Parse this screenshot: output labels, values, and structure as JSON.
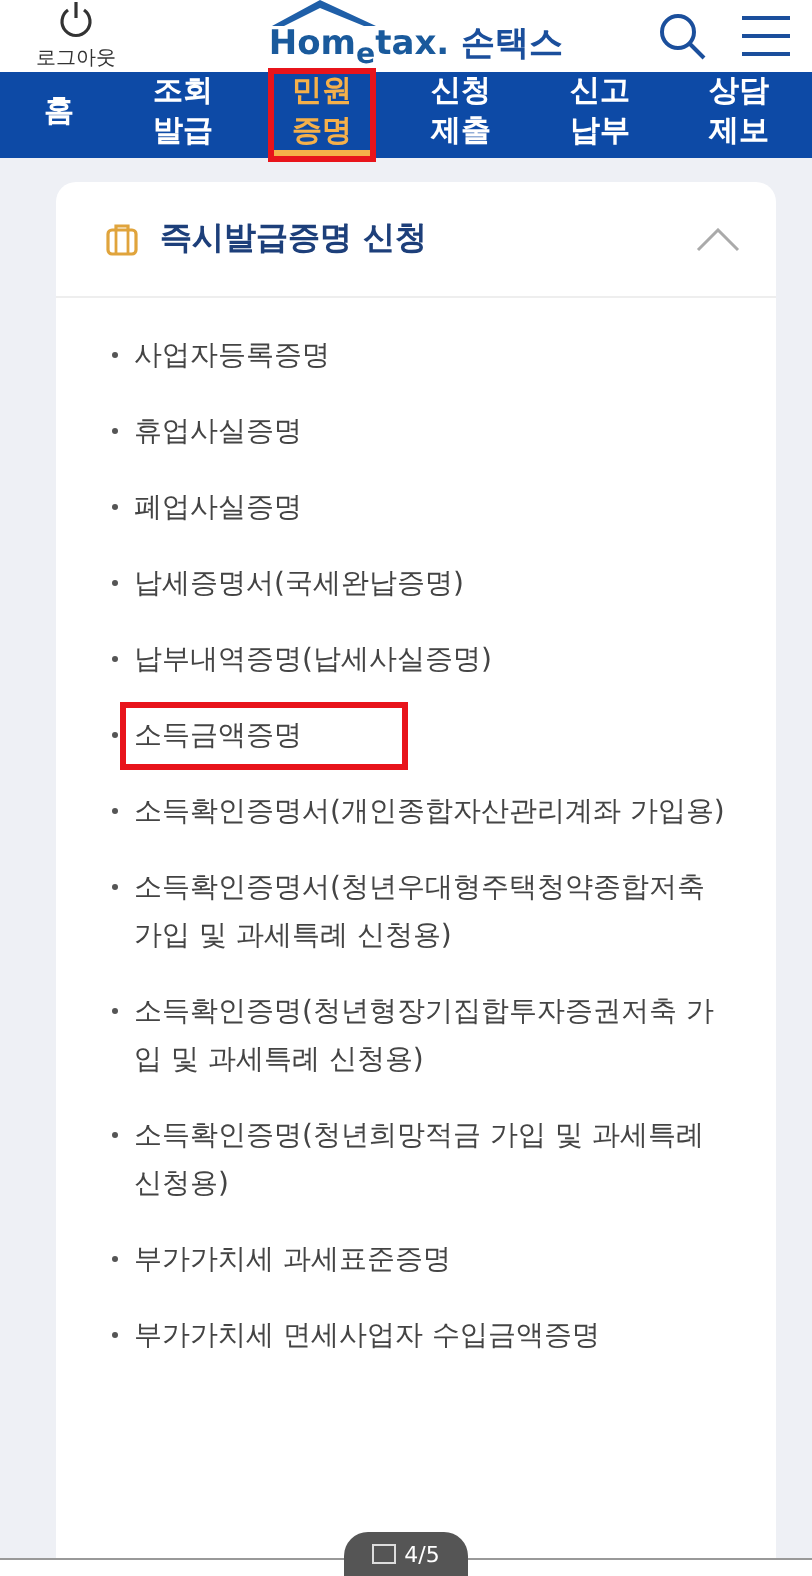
{
  "header": {
    "logout_label": "로그아웃",
    "logo_brand": "Hom$_{e}$tax.",
    "logo_name": "손택스"
  },
  "tabs": [
    {
      "label": "홈",
      "selected": false,
      "highlighted": false
    },
    {
      "label": "조회\n발급",
      "selected": false,
      "highlighted": false
    },
    {
      "label": "민원\n증명",
      "selected": true,
      "highlighted": true
    },
    {
      "label": "신청\n제출",
      "selected": false,
      "highlighted": false
    },
    {
      "label": "신고\n납부",
      "selected": false,
      "highlighted": false
    },
    {
      "label": "상담\n제보",
      "selected": false,
      "highlighted": false
    }
  ],
  "section": {
    "title": "즉시발급증명 신청",
    "expanded": true,
    "items": [
      {
        "label": "사업자등록증명",
        "highlighted": false
      },
      {
        "label": "휴업사실증명",
        "highlighted": false
      },
      {
        "label": "폐업사실증명",
        "highlighted": false
      },
      {
        "label": "납세증명서(국세완납증명)",
        "highlighted": false
      },
      {
        "label": "납부내역증명(납세사실증명)",
        "highlighted": false
      },
      {
        "label": "소득금액증명",
        "highlighted": true
      },
      {
        "label": "소득확인증명서(개인종합자산관리계좌 가입용)",
        "highlighted": false
      },
      {
        "label": "소득확인증명서(청년우대형주택청약종합저축 가입 및 과세특례 신청용)",
        "highlighted": false
      },
      {
        "label": "소득확인증명(청년형장기집합투자증권저축 가입 및 과세특례 신청용)",
        "highlighted": false
      },
      {
        "label": "소득확인증명(청년희망적금 가입 및 과세특례 신청용)",
        "highlighted": false
      },
      {
        "label": "부가가치세 과세표준증명",
        "highlighted": false
      },
      {
        "label": "부가가치세 면세사업자 수입금액증명",
        "highlighted": false
      }
    ]
  },
  "page_indicator": "4/5"
}
